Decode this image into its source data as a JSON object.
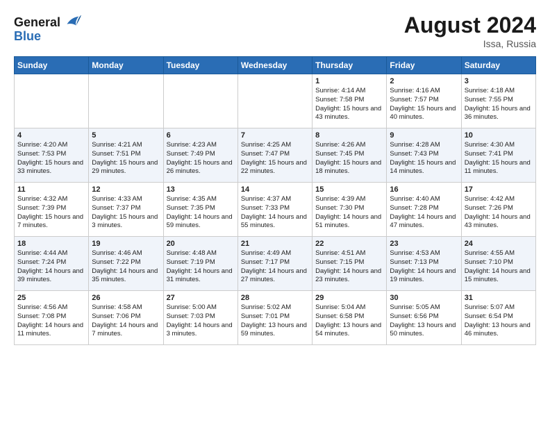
{
  "header": {
    "logo_line1": "General",
    "logo_line2": "Blue",
    "month_year": "August 2024",
    "location": "Issa, Russia"
  },
  "days_of_week": [
    "Sunday",
    "Monday",
    "Tuesday",
    "Wednesday",
    "Thursday",
    "Friday",
    "Saturday"
  ],
  "weeks": [
    [
      {
        "day": "",
        "sunrise": "",
        "sunset": "",
        "daylight": "",
        "empty": true
      },
      {
        "day": "",
        "sunrise": "",
        "sunset": "",
        "daylight": "",
        "empty": true
      },
      {
        "day": "",
        "sunrise": "",
        "sunset": "",
        "daylight": "",
        "empty": true
      },
      {
        "day": "",
        "sunrise": "",
        "sunset": "",
        "daylight": "",
        "empty": true
      },
      {
        "day": "1",
        "sunrise": "Sunrise: 4:14 AM",
        "sunset": "Sunset: 7:58 PM",
        "daylight": "Daylight: 15 hours and 43 minutes."
      },
      {
        "day": "2",
        "sunrise": "Sunrise: 4:16 AM",
        "sunset": "Sunset: 7:57 PM",
        "daylight": "Daylight: 15 hours and 40 minutes."
      },
      {
        "day": "3",
        "sunrise": "Sunrise: 4:18 AM",
        "sunset": "Sunset: 7:55 PM",
        "daylight": "Daylight: 15 hours and 36 minutes."
      }
    ],
    [
      {
        "day": "4",
        "sunrise": "Sunrise: 4:20 AM",
        "sunset": "Sunset: 7:53 PM",
        "daylight": "Daylight: 15 hours and 33 minutes."
      },
      {
        "day": "5",
        "sunrise": "Sunrise: 4:21 AM",
        "sunset": "Sunset: 7:51 PM",
        "daylight": "Daylight: 15 hours and 29 minutes."
      },
      {
        "day": "6",
        "sunrise": "Sunrise: 4:23 AM",
        "sunset": "Sunset: 7:49 PM",
        "daylight": "Daylight: 15 hours and 26 minutes."
      },
      {
        "day": "7",
        "sunrise": "Sunrise: 4:25 AM",
        "sunset": "Sunset: 7:47 PM",
        "daylight": "Daylight: 15 hours and 22 minutes."
      },
      {
        "day": "8",
        "sunrise": "Sunrise: 4:26 AM",
        "sunset": "Sunset: 7:45 PM",
        "daylight": "Daylight: 15 hours and 18 minutes."
      },
      {
        "day": "9",
        "sunrise": "Sunrise: 4:28 AM",
        "sunset": "Sunset: 7:43 PM",
        "daylight": "Daylight: 15 hours and 14 minutes."
      },
      {
        "day": "10",
        "sunrise": "Sunrise: 4:30 AM",
        "sunset": "Sunset: 7:41 PM",
        "daylight": "Daylight: 15 hours and 11 minutes."
      }
    ],
    [
      {
        "day": "11",
        "sunrise": "Sunrise: 4:32 AM",
        "sunset": "Sunset: 7:39 PM",
        "daylight": "Daylight: 15 hours and 7 minutes."
      },
      {
        "day": "12",
        "sunrise": "Sunrise: 4:33 AM",
        "sunset": "Sunset: 7:37 PM",
        "daylight": "Daylight: 15 hours and 3 minutes."
      },
      {
        "day": "13",
        "sunrise": "Sunrise: 4:35 AM",
        "sunset": "Sunset: 7:35 PM",
        "daylight": "Daylight: 14 hours and 59 minutes."
      },
      {
        "day": "14",
        "sunrise": "Sunrise: 4:37 AM",
        "sunset": "Sunset: 7:33 PM",
        "daylight": "Daylight: 14 hours and 55 minutes."
      },
      {
        "day": "15",
        "sunrise": "Sunrise: 4:39 AM",
        "sunset": "Sunset: 7:30 PM",
        "daylight": "Daylight: 14 hours and 51 minutes."
      },
      {
        "day": "16",
        "sunrise": "Sunrise: 4:40 AM",
        "sunset": "Sunset: 7:28 PM",
        "daylight": "Daylight: 14 hours and 47 minutes."
      },
      {
        "day": "17",
        "sunrise": "Sunrise: 4:42 AM",
        "sunset": "Sunset: 7:26 PM",
        "daylight": "Daylight: 14 hours and 43 minutes."
      }
    ],
    [
      {
        "day": "18",
        "sunrise": "Sunrise: 4:44 AM",
        "sunset": "Sunset: 7:24 PM",
        "daylight": "Daylight: 14 hours and 39 minutes."
      },
      {
        "day": "19",
        "sunrise": "Sunrise: 4:46 AM",
        "sunset": "Sunset: 7:22 PM",
        "daylight": "Daylight: 14 hours and 35 minutes."
      },
      {
        "day": "20",
        "sunrise": "Sunrise: 4:48 AM",
        "sunset": "Sunset: 7:19 PM",
        "daylight": "Daylight: 14 hours and 31 minutes."
      },
      {
        "day": "21",
        "sunrise": "Sunrise: 4:49 AM",
        "sunset": "Sunset: 7:17 PM",
        "daylight": "Daylight: 14 hours and 27 minutes."
      },
      {
        "day": "22",
        "sunrise": "Sunrise: 4:51 AM",
        "sunset": "Sunset: 7:15 PM",
        "daylight": "Daylight: 14 hours and 23 minutes."
      },
      {
        "day": "23",
        "sunrise": "Sunrise: 4:53 AM",
        "sunset": "Sunset: 7:13 PM",
        "daylight": "Daylight: 14 hours and 19 minutes."
      },
      {
        "day": "24",
        "sunrise": "Sunrise: 4:55 AM",
        "sunset": "Sunset: 7:10 PM",
        "daylight": "Daylight: 14 hours and 15 minutes."
      }
    ],
    [
      {
        "day": "25",
        "sunrise": "Sunrise: 4:56 AM",
        "sunset": "Sunset: 7:08 PM",
        "daylight": "Daylight: 14 hours and 11 minutes."
      },
      {
        "day": "26",
        "sunrise": "Sunrise: 4:58 AM",
        "sunset": "Sunset: 7:06 PM",
        "daylight": "Daylight: 14 hours and 7 minutes."
      },
      {
        "day": "27",
        "sunrise": "Sunrise: 5:00 AM",
        "sunset": "Sunset: 7:03 PM",
        "daylight": "Daylight: 14 hours and 3 minutes."
      },
      {
        "day": "28",
        "sunrise": "Sunrise: 5:02 AM",
        "sunset": "Sunset: 7:01 PM",
        "daylight": "Daylight: 13 hours and 59 minutes."
      },
      {
        "day": "29",
        "sunrise": "Sunrise: 5:04 AM",
        "sunset": "Sunset: 6:58 PM",
        "daylight": "Daylight: 13 hours and 54 minutes."
      },
      {
        "day": "30",
        "sunrise": "Sunrise: 5:05 AM",
        "sunset": "Sunset: 6:56 PM",
        "daylight": "Daylight: 13 hours and 50 minutes."
      },
      {
        "day": "31",
        "sunrise": "Sunrise: 5:07 AM",
        "sunset": "Sunset: 6:54 PM",
        "daylight": "Daylight: 13 hours and 46 minutes."
      }
    ]
  ]
}
